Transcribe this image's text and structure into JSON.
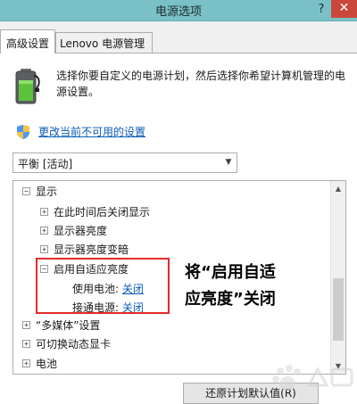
{
  "window": {
    "title": "电源选项",
    "help_glyph": "?",
    "close_glyph": "✕"
  },
  "tabs": [
    {
      "label": "高级设置",
      "active": true
    },
    {
      "label": "Lenovo 电源管理",
      "active": false
    }
  ],
  "description": "选择你要自定义的电源计划，然后选择你希望计算机管理的电源设置。",
  "change_link": "更改当前不可用的设置",
  "plan_select": {
    "value": "平衡 [活动]"
  },
  "tree": {
    "display": {
      "label": "显示",
      "expander": "−"
    },
    "turn_off_after": {
      "label": "在此时间后关闭显示",
      "expander": "+"
    },
    "brightness": {
      "label": "显示器亮度",
      "expander": "+"
    },
    "dimmed_brightness": {
      "label": "显示器亮度变暗",
      "expander": "+"
    },
    "adaptive": {
      "label": "启用自适应亮度",
      "expander": "−"
    },
    "on_battery": {
      "label": "使用电池:",
      "value": "关闭"
    },
    "plugged_in": {
      "label": "接通电源:",
      "value": "关闭"
    },
    "multimedia": {
      "label": "“多媒体”设置",
      "expander": "+"
    },
    "switchable_graphics": {
      "label": "可切换动态显卡",
      "expander": "+"
    },
    "battery": {
      "label": "电池",
      "expander": "+"
    }
  },
  "annotation": {
    "line1": "将“启用自适",
    "line2": "应亮度”关闭"
  },
  "restore_button": "还原计划默认值(R)",
  "accent_colors": {
    "titlebar": "#79c1c6",
    "close": "#c9483b",
    "link": "#0b5bb8",
    "highlight": "#e32b2b"
  }
}
